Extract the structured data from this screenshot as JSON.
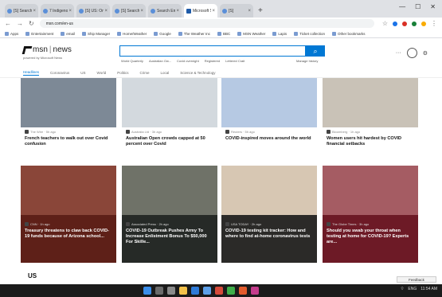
{
  "browser": {
    "tabs": [
      {
        "label": "[S] Search"
      },
      {
        "label": "7 Indigenous Voic"
      },
      {
        "label": "[S] US: Ontario"
      },
      {
        "label": "[S] Search"
      },
      {
        "label": "Search Employee"
      },
      {
        "label": "Microsoft Start",
        "active": true
      },
      {
        "label": "[S]"
      }
    ],
    "new_tab": "+",
    "url": "msn.com/en-us",
    "bookmarks": [
      "Apps",
      "Entertainment",
      "email",
      "Ship Manager",
      "Home/Weather",
      "Google",
      "The Weather Inc",
      "BBC",
      "MSN Weather",
      "Lapis",
      "Ticket collection",
      "Other bookmarks"
    ]
  },
  "msn": {
    "logo": "msn",
    "logo_suffix": "news",
    "powered": "powered by Microsoft News",
    "search_button": "⌕",
    "quick_links": [
      "World Quarterly",
      "Australian Ow...",
      "Covid overnight",
      "Registered",
      "Lettered Crait"
    ],
    "manage_history": "Manage history",
    "more": "···",
    "categories": [
      "Headlines",
      "Coronavirus",
      "US",
      "World",
      "Politics",
      "Crime",
      "Local",
      "Science & Technology"
    ]
  },
  "news": {
    "row1": [
      {
        "source": "The Wire · 5h ago",
        "title": "French teachers to walk out over Covid confusion",
        "img": "#7d8996"
      },
      {
        "source": "Australia Ltd · 3h ago",
        "title": "Australian Open crowds capped at 50 percent over Covid",
        "img": "#d3d9de"
      },
      {
        "source": "Reuters · 5h ago",
        "title": "COVID-inspired moves around the world",
        "img": "#b6c9e3"
      },
      {
        "source": "Bloomberg · 1h ago",
        "title": "Women users hit hardest by COVID financial setbacks",
        "img": "#c9c2b7"
      }
    ],
    "row2": [
      {
        "source": "CNN · 1h ago",
        "title": "Treasury threatens to claw back COVID-19 funds because of Arizona school...",
        "img": "#8a4639",
        "panel": "#5e2018"
      },
      {
        "source": "Associated Press · 2h ago",
        "title": "COVID-19 Outbreak Pushes Army To Increase Enlistment Bonus To $50,000 For Skille...",
        "img": "#6f7268",
        "panel": "#262a27"
      },
      {
        "source": "USA TODAY · 2h ago",
        "title": "COVID-19 testing kit tracker: How and where to find at-home coronavirus tests",
        "img": "#d7c7b3",
        "panel": "#2b2a28"
      },
      {
        "source": "The Globe Times · 3h ago",
        "title": "Should you swab your throat when testing at home for COVID-19? Experts are...",
        "img": "#a55c63",
        "panel": "#6d1a26"
      }
    ]
  },
  "us_section": "US",
  "feedback": "Feedback",
  "taskbar": {
    "tray": "ENG",
    "time": "11:54 AM"
  }
}
